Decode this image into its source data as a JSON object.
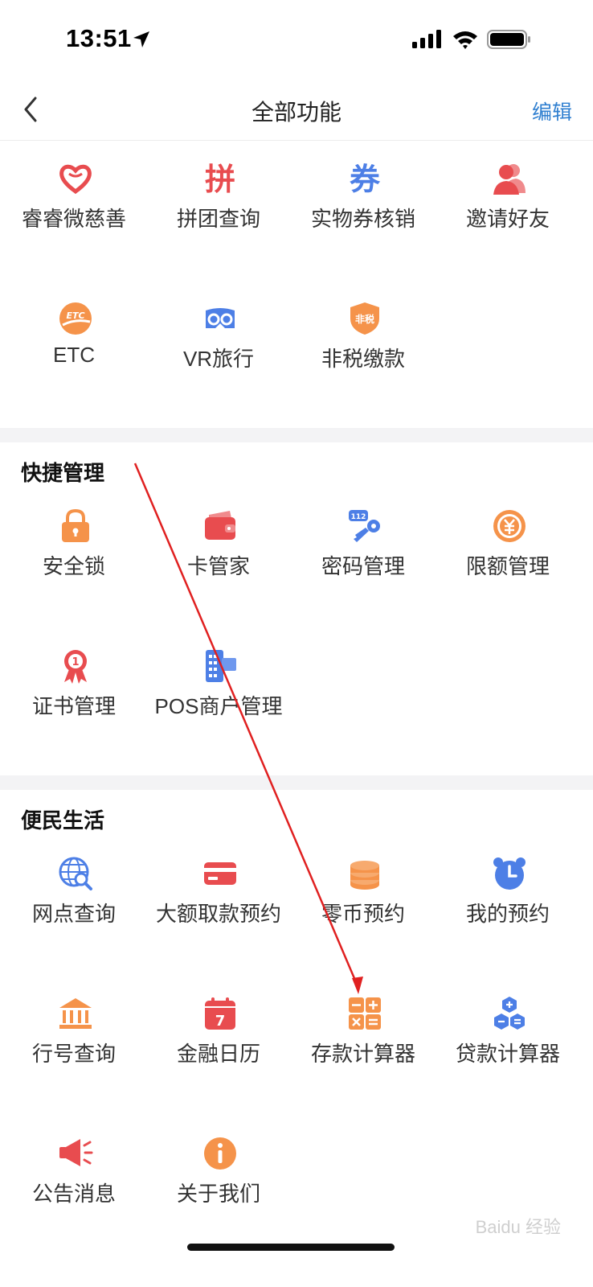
{
  "status_bar": {
    "time": "13:51"
  },
  "nav": {
    "title": "全部功能",
    "edit_label": "编辑"
  },
  "top_grid": [
    {
      "label": "睿睿微慈善",
      "icon": "heart-icon"
    },
    {
      "label": "拼团查询",
      "icon": "pin-char-icon",
      "glyph": "拼"
    },
    {
      "label": "实物券核销",
      "icon": "coupon-char-icon",
      "glyph": "券"
    },
    {
      "label": "邀请好友",
      "icon": "invite-friends-icon"
    },
    {
      "label": "ETC",
      "icon": "etc-icon",
      "glyph": "ETC"
    },
    {
      "label": "VR旅行",
      "icon": "vr-goggles-icon"
    },
    {
      "label": "非税缴款",
      "icon": "tax-shield-icon",
      "glyph": "非税"
    }
  ],
  "quick_manage": {
    "title": "快捷管理",
    "items": [
      {
        "label": "安全锁",
        "icon": "lock-icon"
      },
      {
        "label": "卡管家",
        "icon": "wallet-icon"
      },
      {
        "label": "密码管理",
        "icon": "password-key-icon",
        "glyph": "112"
      },
      {
        "label": "限额管理",
        "icon": "limit-coin-icon"
      },
      {
        "label": "证书管理",
        "icon": "certificate-badge-icon",
        "glyph": "1"
      },
      {
        "label": "POS商户管理",
        "icon": "pos-terminal-icon"
      }
    ]
  },
  "convenience": {
    "title": "便民生活",
    "items": [
      {
        "label": "网点查询",
        "icon": "branch-search-icon"
      },
      {
        "label": "大额取款预约",
        "icon": "bank-card-icon"
      },
      {
        "label": "零币预约",
        "icon": "coin-stack-icon"
      },
      {
        "label": "我的预约",
        "icon": "alarm-clock-icon"
      },
      {
        "label": "行号查询",
        "icon": "bank-building-icon"
      },
      {
        "label": "金融日历",
        "icon": "calendar-icon",
        "glyph": "7"
      },
      {
        "label": "存款计算器",
        "icon": "calculator-icon"
      },
      {
        "label": "贷款计算器",
        "icon": "loan-calculator-icon"
      },
      {
        "label": "公告消息",
        "icon": "megaphone-icon"
      },
      {
        "label": "关于我们",
        "icon": "info-icon"
      }
    ]
  },
  "watermark": "Baidu 经验",
  "colors": {
    "accent": "#2f7fd0",
    "red": "#e84c4f",
    "orange": "#f5934a",
    "blue": "#4d7fe6"
  }
}
